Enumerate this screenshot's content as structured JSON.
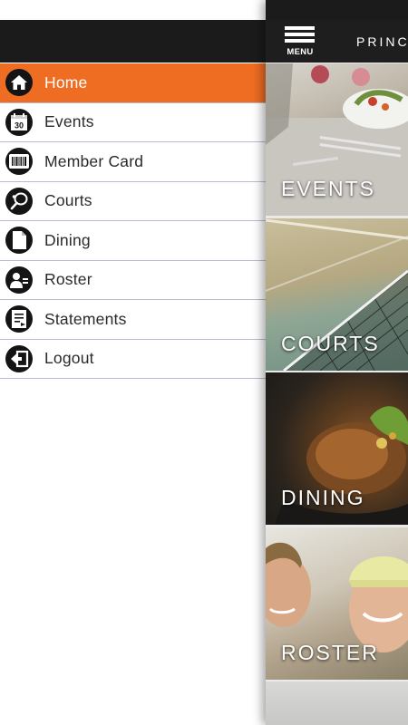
{
  "drawer": {
    "items": [
      {
        "label": "Home",
        "icon": "home-icon",
        "active": true
      },
      {
        "label": "Events",
        "icon": "calendar-icon",
        "active": false
      },
      {
        "label": "Member Card",
        "icon": "barcode-icon",
        "active": false
      },
      {
        "label": "Courts",
        "icon": "tennis-racket-icon",
        "active": false
      },
      {
        "label": "Dining",
        "icon": "document-icon",
        "active": false
      },
      {
        "label": "Roster",
        "icon": "person-icon",
        "active": false
      },
      {
        "label": "Statements",
        "icon": "statement-icon",
        "active": false
      },
      {
        "label": "Logout",
        "icon": "logout-icon",
        "active": false
      }
    ],
    "calendar_day": "30"
  },
  "header": {
    "menu_label": "MENU",
    "title": "PRINC"
  },
  "tiles": [
    {
      "caption": "EVENTS"
    },
    {
      "caption": "COURTS"
    },
    {
      "caption": "DINING"
    },
    {
      "caption": "ROSTER"
    }
  ],
  "colors": {
    "accent": "#ee6d23",
    "header": "#1c1b1b",
    "divider": "#b9bccc",
    "icon_circle": "#141414"
  }
}
